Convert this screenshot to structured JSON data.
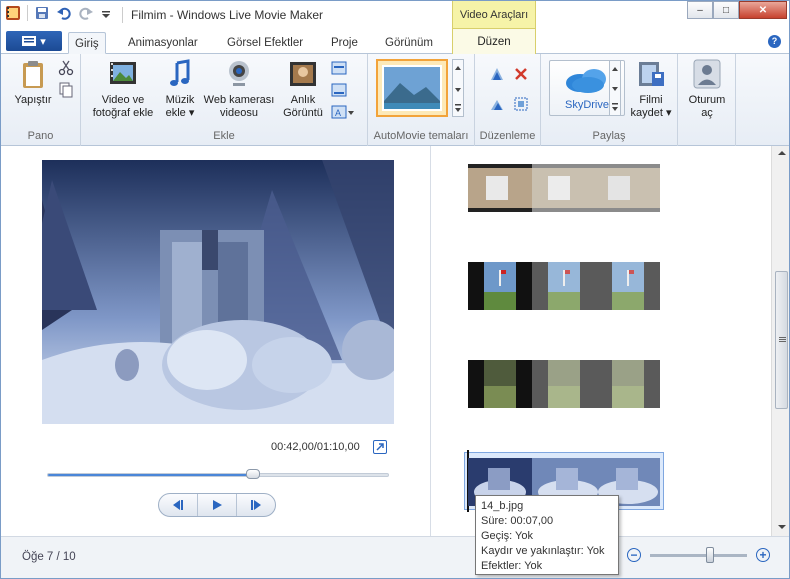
{
  "window": {
    "title": "Filmim - Windows Live Movie Maker",
    "context_tab_group": "Video Araçları",
    "controls": {
      "minimize": "–",
      "maximize": "□",
      "close": "✕"
    }
  },
  "ribbon": {
    "app_menu_label": "▾",
    "tabs": [
      {
        "label": "Giriş"
      },
      {
        "label": "Animasyonlar"
      },
      {
        "label": "Görsel Efektler"
      },
      {
        "label": "Proje"
      },
      {
        "label": "Görünüm"
      }
    ],
    "context_tab": "Düzen",
    "help_label": "?",
    "groups": {
      "pano": {
        "label": "Pano",
        "paste": "Yapıştır"
      },
      "ekle": {
        "label": "Ekle",
        "video_photo": [
          "Video ve",
          "fotoğraf ekle"
        ],
        "music": [
          "Müzik",
          "ekle ▾"
        ],
        "webcam": [
          "Web kamerası",
          "videosu"
        ],
        "snapshot": [
          "Anlık",
          "Görüntü"
        ]
      },
      "automovie": {
        "label": "AutoMovie temaları"
      },
      "duzenleme": {
        "label": "Düzenleme"
      },
      "paylas": {
        "label": "Paylaş",
        "skydrive": "SkyDrive",
        "save_movie": [
          "Filmi",
          "kaydet ▾"
        ]
      },
      "session": [
        "Oturum",
        "aç"
      ]
    }
  },
  "player": {
    "timecode": "00:42,00/01:10,00",
    "progress_fraction": 0.6
  },
  "storyboard": {
    "clips": [
      {
        "name": "clip-1"
      },
      {
        "name": "clip-2"
      },
      {
        "name": "clip-3"
      },
      {
        "name": "clip-4-selected"
      }
    ]
  },
  "tooltip": {
    "lines": [
      "14_b.jpg",
      "Süre: 00:07,00",
      "Geçiş: Yok",
      "Kaydır ve yakınlaştır: Yok",
      "Efektler: Yok"
    ]
  },
  "status": {
    "item_text": "Öğe 7 / 10",
    "zoom_fraction": 0.62
  },
  "colors": {
    "accent": "#2a66c0",
    "context_tab": "#f6f3a8"
  }
}
